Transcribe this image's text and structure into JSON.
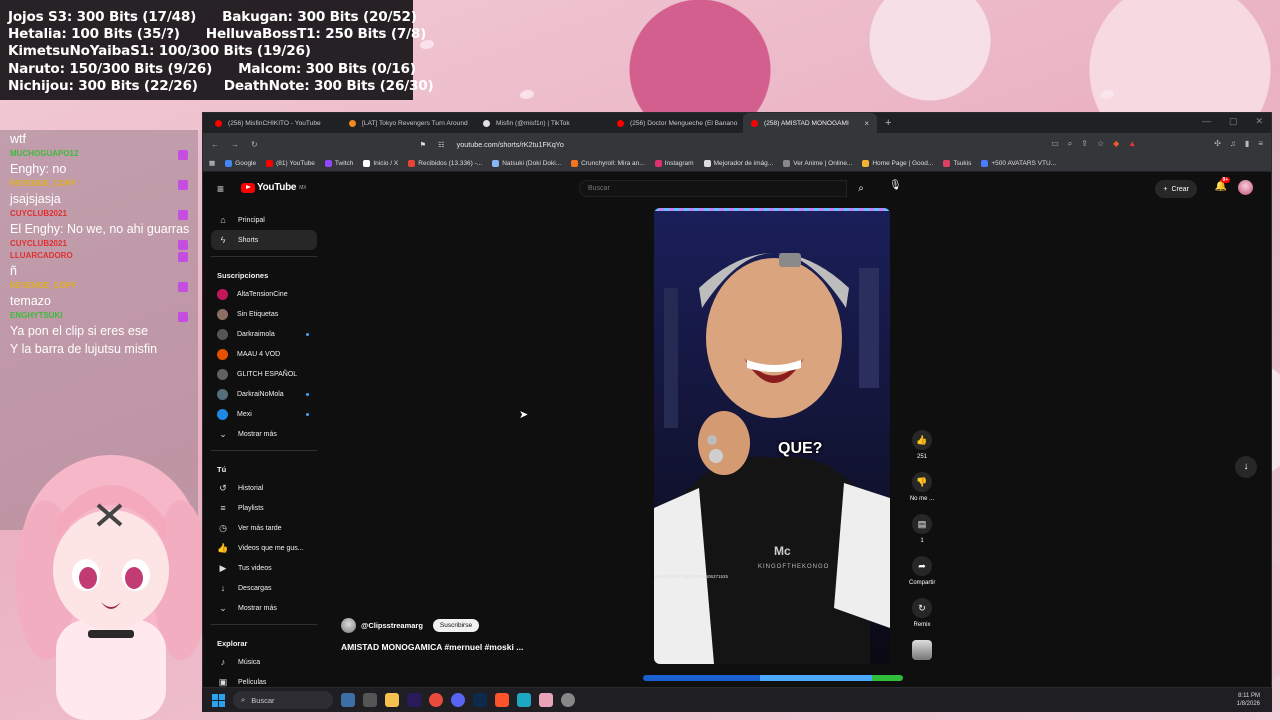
{
  "bits_overlay": {
    "rows": [
      [
        "Jojos S3: 300 Bits (17/48)",
        "Bakugan: 300 Bits (20/52)"
      ],
      [
        "Hetalia: 100 Bits (35/?)",
        "HelluvaBossT1: 250 Bits (7/8)"
      ],
      [
        "KimetsuNoYaibaS1: 100/300 Bits (19/26)"
      ],
      [
        "Naruto: 150/300 Bits (9/26)",
        "Malcom: 300 Bits (0/16)"
      ],
      [
        "Nichijou: 300 Bits (22/26)",
        "DeathNote: 300 Bits (26/30)"
      ]
    ]
  },
  "chat": {
    "messages": [
      {
        "user": "",
        "text": "wtf",
        "color": "#ffffff"
      },
      {
        "user": "MUCHOGUAPO12",
        "text": "Enghy: no",
        "color": "#3dbb3d"
      },
      {
        "user": "REVENGE_COPY",
        "text": "jsajsjasja",
        "color": "#e0b020"
      },
      {
        "user": "CUYCLUB2021",
        "text": "El Enghy: No we, no ahi guarras",
        "color": "#e03030"
      },
      {
        "user": "CUYCLUB2021",
        "text": "",
        "color": "#e03030"
      },
      {
        "user": "LLUARCADORO",
        "text": "ñ",
        "color": "#e03030"
      },
      {
        "user": "REVENGE_COPY",
        "text": "temazo",
        "color": "#e0b020"
      },
      {
        "user": "ENGHYTSUKI",
        "text": "Ya pon el clip si eres ese",
        "color": "#3dbb3d"
      },
      {
        "user": "",
        "text": "Y la barra de lujutsu misfin",
        "color": "#ffffff"
      }
    ]
  },
  "browser": {
    "tabs": [
      {
        "label": "(256) MisfinCHIKITO - YouTube",
        "color": "#ff0000",
        "active": false
      },
      {
        "label": "[LAT] Tokyo Revengers Turn Around",
        "color": "#f28a1e",
        "active": false
      },
      {
        "label": "Misfin (@misf1n) | TikTok",
        "color": "#e0e0e0",
        "active": false
      },
      {
        "label": "(256) Doctor Mengueche (El Banano",
        "color": "#ff0000",
        "active": false
      },
      {
        "label": "(258) AMISTAD MONOGAMI",
        "color": "#ff0000",
        "active": true
      }
    ],
    "url": "youtube.com/shorts/rK2tu1FKqYo",
    "bookmarks": [
      {
        "label": "Google",
        "color": "#4285f4"
      },
      {
        "label": "(81) YouTube",
        "color": "#ff0000"
      },
      {
        "label": "Twitch",
        "color": "#9146ff"
      },
      {
        "label": "Inicio / X",
        "color": "#ffffff"
      },
      {
        "label": "Recibidos (13.336) -...",
        "color": "#ea4335"
      },
      {
        "label": "Natsuki (Doki Doki...",
        "color": "#8ab4f8"
      },
      {
        "label": "Crunchyroll: Mira an...",
        "color": "#f47521"
      },
      {
        "label": "Instagram",
        "color": "#e1306c"
      },
      {
        "label": "Mejorador de imág...",
        "color": "#dddddd"
      },
      {
        "label": "Ver Anime | Online...",
        "color": "#888888"
      },
      {
        "label": "Home Page | Good...",
        "color": "#f2b233"
      },
      {
        "label": "Tsukis",
        "color": "#e04060"
      },
      {
        "label": "+500 AVATARS VTU...",
        "color": "#4a7cff"
      }
    ]
  },
  "youtube": {
    "logo": "YouTube",
    "logo_region": "MX",
    "search_placeholder": "Buscar",
    "create_label": "Crear",
    "notif_count": "9+",
    "sidebar": {
      "main": [
        {
          "label": "Principal",
          "icon": "⌂",
          "icon_name": "home-icon"
        },
        {
          "label": "Shorts",
          "icon": "ϟ",
          "icon_name": "shorts-icon",
          "active": true
        }
      ],
      "subs_title": "Suscripciones",
      "subs": [
        {
          "label": "AltaTensionCine",
          "color": "#c2185b",
          "live": false
        },
        {
          "label": "Sin Etiquetas",
          "color": "#8d6e63",
          "live": false
        },
        {
          "label": "Darkraimola",
          "color": "#555555",
          "live": true
        },
        {
          "label": "MAAU 4 VOD",
          "color": "#e65100",
          "live": false
        },
        {
          "label": "GLITCH ESPAÑOL",
          "color": "#616161",
          "live": false
        },
        {
          "label": "DarkraiNoMola",
          "color": "#546e7a",
          "live": true
        },
        {
          "label": "Mexi",
          "color": "#1e88e5",
          "live": true
        }
      ],
      "subs_more": "Mostrar más",
      "you_title": "Tú",
      "you": [
        {
          "label": "Historial",
          "icon": "↺",
          "icon_name": "history-icon"
        },
        {
          "label": "Playlists",
          "icon": "≡",
          "icon_name": "playlists-icon"
        },
        {
          "label": "Ver más tarde",
          "icon": "◷",
          "icon_name": "watch-later-icon"
        },
        {
          "label": "Videos que me gus...",
          "icon": "👍",
          "icon_name": "liked-icon"
        },
        {
          "label": "Tus videos",
          "icon": "▶",
          "icon_name": "your-videos-icon"
        },
        {
          "label": "Descargas",
          "icon": "↓",
          "icon_name": "downloads-icon"
        }
      ],
      "you_more": "Mostrar más",
      "explore_title": "Explorar",
      "explore": [
        {
          "label": "Música",
          "icon": "♪",
          "icon_name": "music-icon"
        },
        {
          "label": "Películas",
          "icon": "▣",
          "icon_name": "movies-icon"
        }
      ]
    },
    "short": {
      "caption": "QUE?",
      "shirt_text": "Mc",
      "shirt_sub": "KINGOFTHEKONGO",
      "tiny_text": "mirezz/video/7463649608506371525",
      "channel": "@Clipsstreamarg",
      "subscribe": "Suscribirse",
      "title": "AMISTAD MONOGAMICA #mernuel #moski ..."
    },
    "actions": [
      {
        "icon": "👍",
        "name": "like-icon",
        "label": "251"
      },
      {
        "icon": "👎",
        "name": "dislike-icon",
        "label": "No me ..."
      },
      {
        "icon": "▤",
        "name": "comments-icon",
        "label": "1"
      },
      {
        "icon": "➦",
        "name": "share-icon",
        "label": "Compartir"
      },
      {
        "icon": "↻",
        "name": "remix-icon",
        "label": "Remix"
      }
    ]
  },
  "taskbar": {
    "search_label": "Buscar",
    "time": "8:11 PM",
    "date": "1/8/2026"
  }
}
